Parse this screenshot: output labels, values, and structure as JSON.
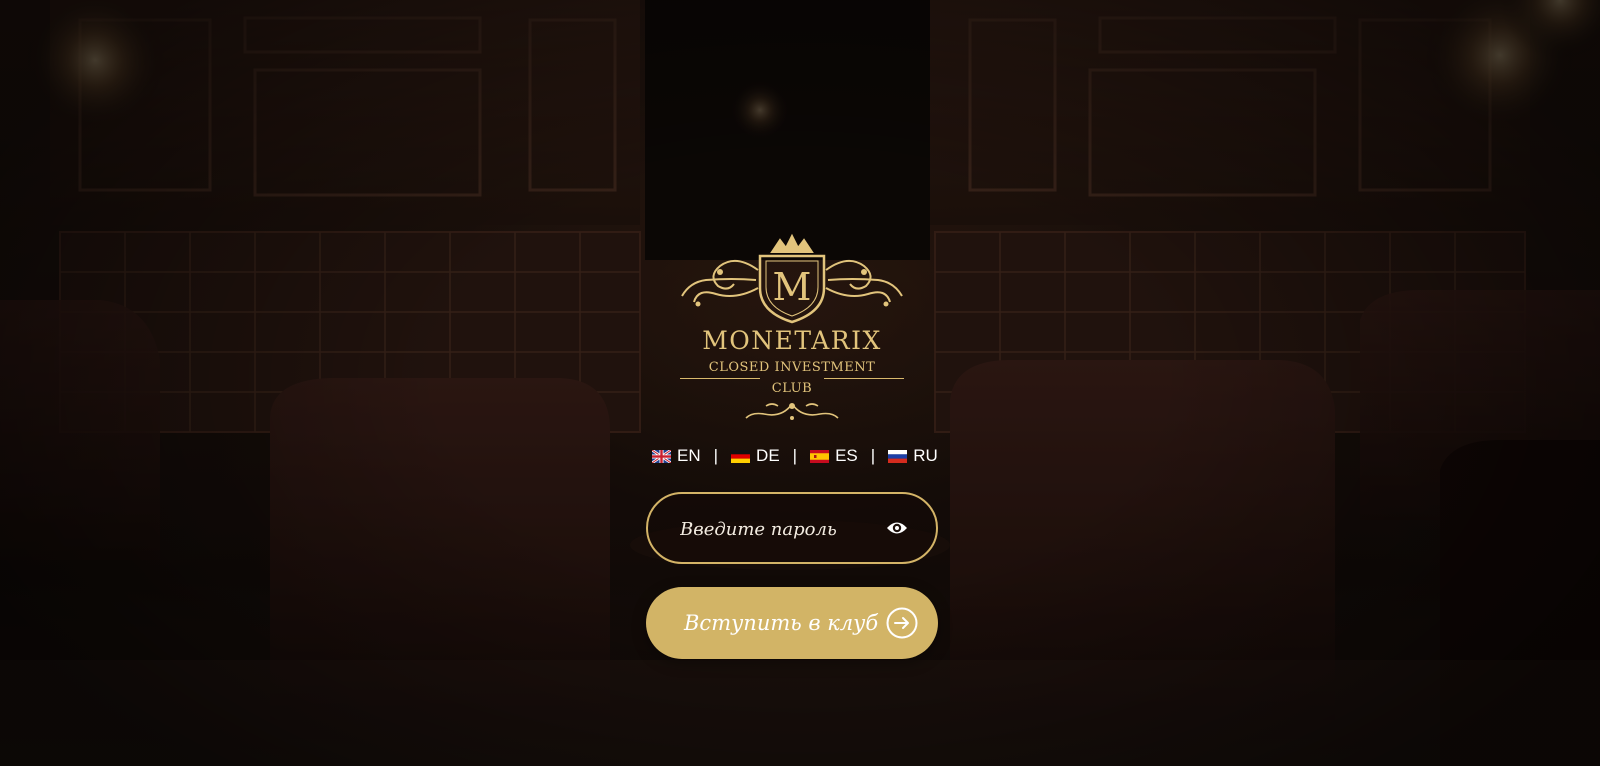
{
  "brand": {
    "name": "MONETARIX",
    "tagline_line1": "CLOSED INVESTMENT",
    "tagline_line2": "CLUB",
    "monogram": "M",
    "gold": "#d2b466"
  },
  "languages": [
    {
      "code": "EN",
      "flag": "uk-flag-icon"
    },
    {
      "code": "DE",
      "flag": "germany-flag-icon"
    },
    {
      "code": "ES",
      "flag": "spain-flag-icon"
    },
    {
      "code": "RU",
      "flag": "russia-flag-icon"
    }
  ],
  "language_separator": "|",
  "login": {
    "password_placeholder": "Введите пароль",
    "password_value": "",
    "show_password_icon": "eye-icon",
    "submit_label": "Вступить в клуб",
    "submit_icon": "arrow-right-circle-icon"
  }
}
